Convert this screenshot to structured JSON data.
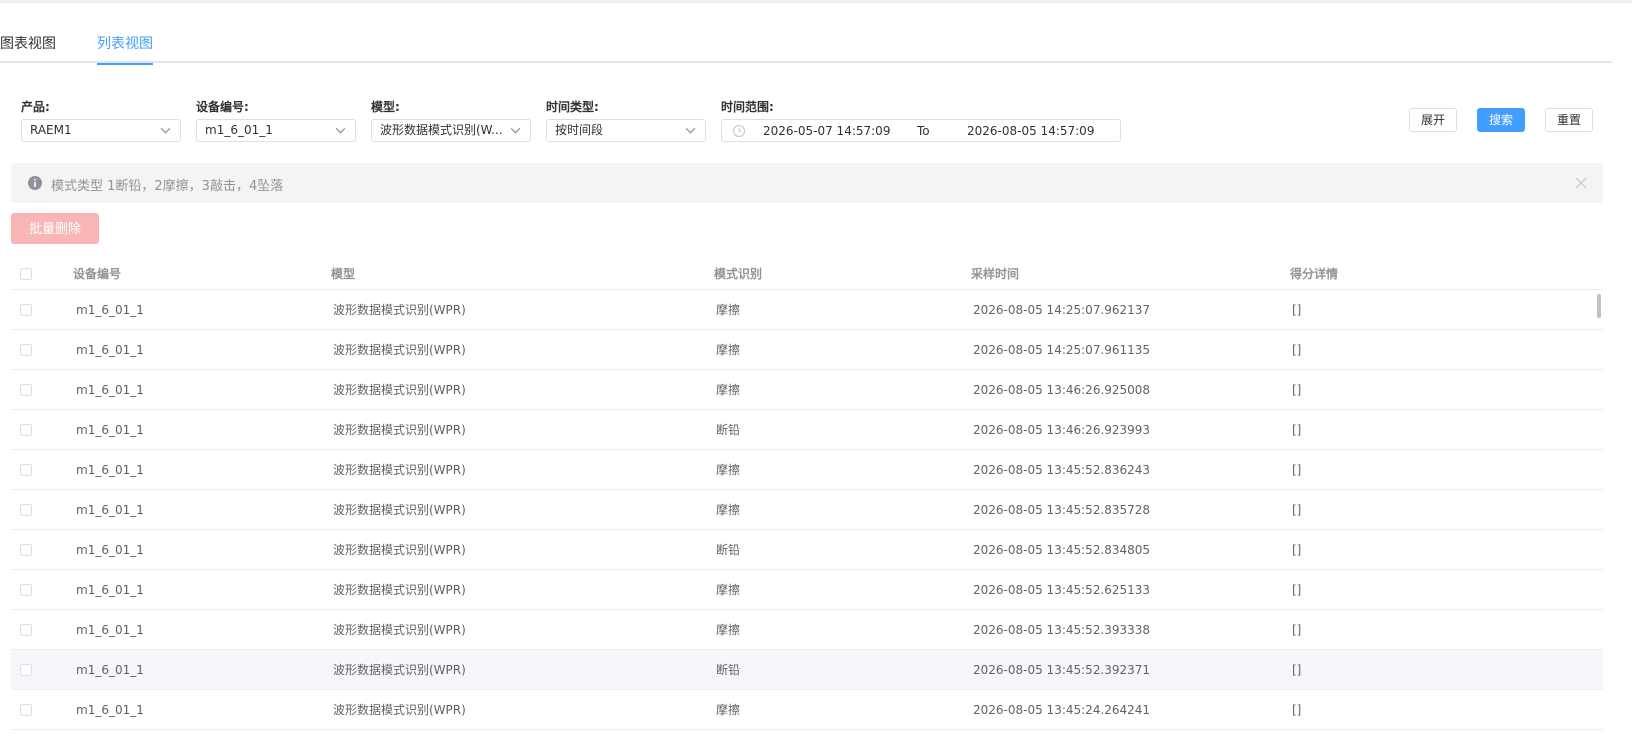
{
  "tabs": [
    {
      "label": "图表视图"
    },
    {
      "label": "列表视图"
    }
  ],
  "filters": {
    "product": {
      "label": "产品:",
      "value": "RAEM1"
    },
    "device": {
      "label": "设备编号:",
      "value": "m1_6_01_1"
    },
    "model": {
      "label": "模型:",
      "value": "波形数据模式识别(W..."
    },
    "time_type": {
      "label": "时间类型:",
      "value": "按时间段"
    },
    "time_range": {
      "label": "时间范围:",
      "start": "2026-05-07 14:57:09",
      "separator": "To",
      "end": "2026-08-05 14:57:09"
    }
  },
  "buttons": {
    "expand": "展开",
    "search": "搜索",
    "reset": "重置",
    "batch_delete": "批量删除"
  },
  "alert": {
    "message": "模式类型 1断铅，2摩擦，3敲击，4坠落"
  },
  "table": {
    "headers": [
      "设备编号",
      "模型",
      "模式识别",
      "采样时间",
      "得分详情"
    ],
    "rows": [
      {
        "device": "m1_6_01_1",
        "model": "波形数据模式识别(WPR)",
        "mode": "摩擦",
        "time": "2026-08-05 14:25:07.962137",
        "score": "[]"
      },
      {
        "device": "m1_6_01_1",
        "model": "波形数据模式识别(WPR)",
        "mode": "摩擦",
        "time": "2026-08-05 14:25:07.961135",
        "score": "[]"
      },
      {
        "device": "m1_6_01_1",
        "model": "波形数据模式识别(WPR)",
        "mode": "摩擦",
        "time": "2026-08-05 13:46:26.925008",
        "score": "[]"
      },
      {
        "device": "m1_6_01_1",
        "model": "波形数据模式识别(WPR)",
        "mode": "断铅",
        "time": "2026-08-05 13:46:26.923993",
        "score": "[]"
      },
      {
        "device": "m1_6_01_1",
        "model": "波形数据模式识别(WPR)",
        "mode": "摩擦",
        "time": "2026-08-05 13:45:52.836243",
        "score": "[]"
      },
      {
        "device": "m1_6_01_1",
        "model": "波形数据模式识别(WPR)",
        "mode": "摩擦",
        "time": "2026-08-05 13:45:52.835728",
        "score": "[]"
      },
      {
        "device": "m1_6_01_1",
        "model": "波形数据模式识别(WPR)",
        "mode": "断铅",
        "time": "2026-08-05 13:45:52.834805",
        "score": "[]"
      },
      {
        "device": "m1_6_01_1",
        "model": "波形数据模式识别(WPR)",
        "mode": "摩擦",
        "time": "2026-08-05 13:45:52.625133",
        "score": "[]"
      },
      {
        "device": "m1_6_01_1",
        "model": "波形数据模式识别(WPR)",
        "mode": "摩擦",
        "time": "2026-08-05 13:45:52.393338",
        "score": "[]"
      },
      {
        "device": "m1_6_01_1",
        "model": "波形数据模式识别(WPR)",
        "mode": "断铅",
        "time": "2026-08-05 13:45:52.392371",
        "score": "[]"
      },
      {
        "device": "m1_6_01_1",
        "model": "波形数据模式识别(WPR)",
        "mode": "摩擦",
        "time": "2026-08-05 13:45:24.264241",
        "score": "[]"
      }
    ]
  },
  "colors": {
    "primary": "#409eff",
    "danger_light": "#fab6b6",
    "alert_bg": "#f4f4f5"
  },
  "icons": [
    "chevron-down-icon",
    "clock-icon",
    "info-icon",
    "close-icon"
  ]
}
